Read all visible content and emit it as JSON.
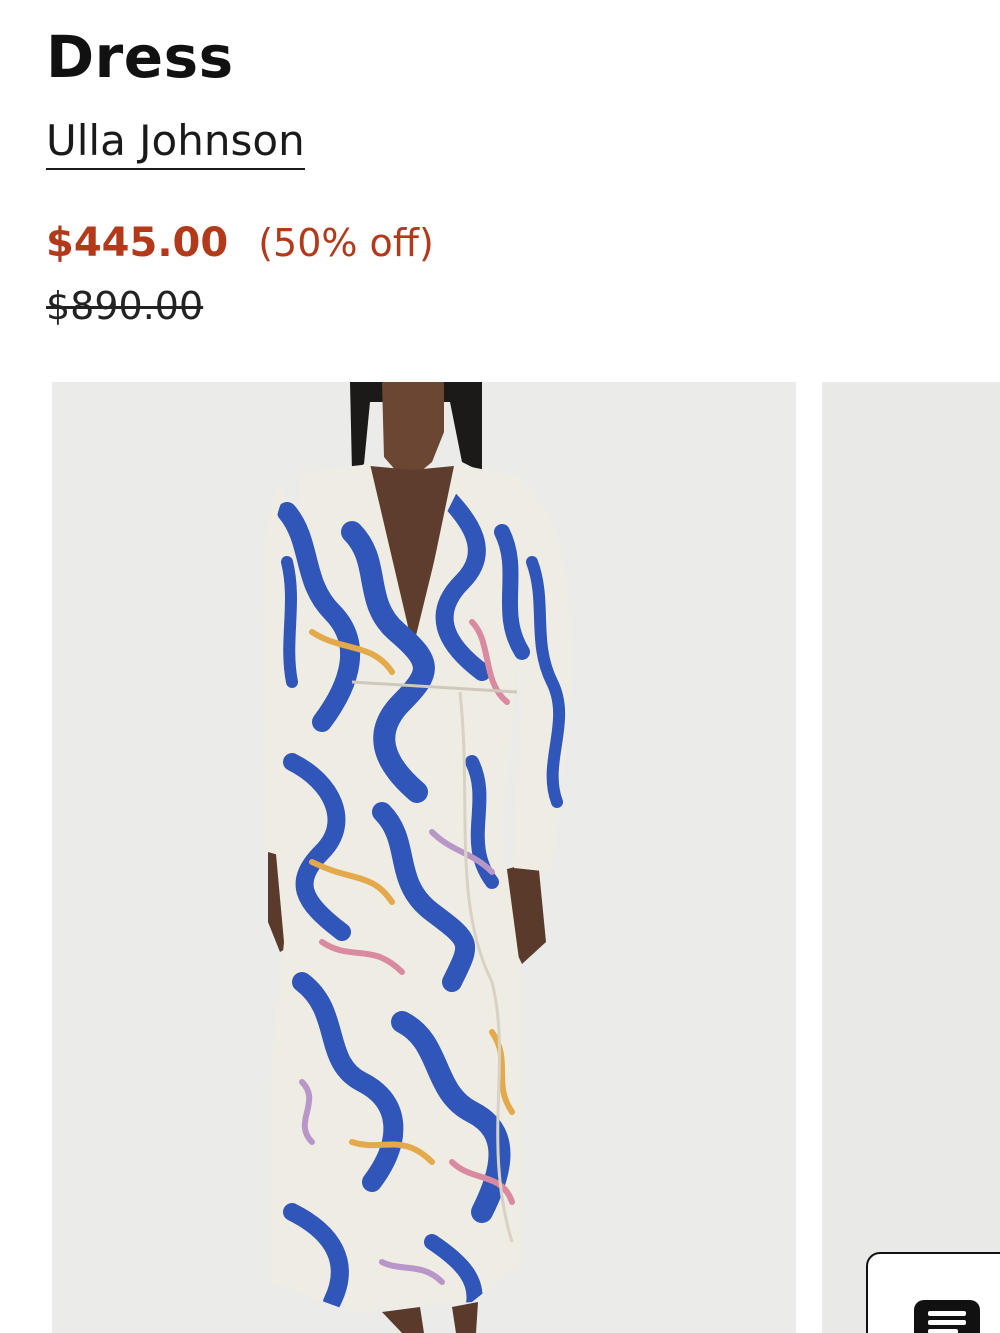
{
  "product": {
    "title_line_visible": "Dress",
    "brand": "Ulla Johnson",
    "sale_price": "$445.00",
    "discount": "(50% off)",
    "original_price": "$890.00"
  },
  "colors": {
    "sale": "#b23a1a",
    "text": "#1a1a1a",
    "image_bg": "#ebebea",
    "dress_blue": "#2f56b8",
    "dress_cream": "#efece3"
  },
  "icons": {
    "chat": "chat-bubble-icon"
  }
}
